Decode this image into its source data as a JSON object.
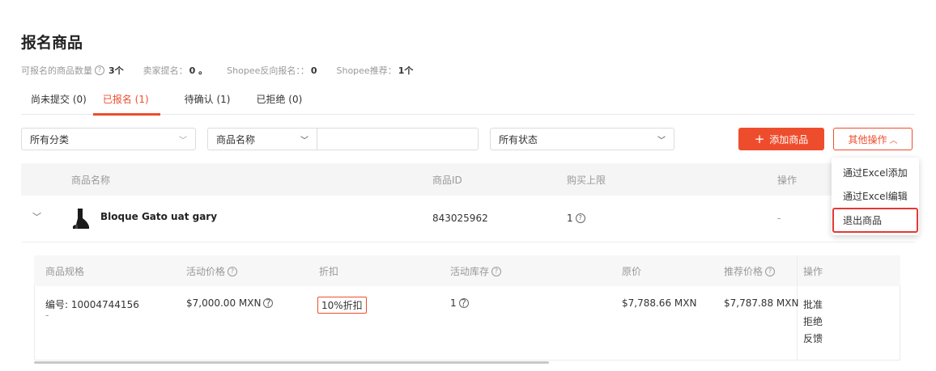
{
  "page": {
    "title": "报名商品"
  },
  "stats": {
    "registerable_label": "可报名的商品数量",
    "registerable_value": "3个",
    "seller_label": "卖家提名：",
    "seller_value": "0 。",
    "shopee_reverse_label": "Shopee反向报名：：",
    "shopee_reverse_value": "0",
    "shopee_recommend_label": "Shopee推荐：",
    "shopee_recommend_value": "1个"
  },
  "tabs": [
    {
      "label": "尚未提交 (0)"
    },
    {
      "label": "已报名 (1)",
      "active": true
    },
    {
      "label": "待确认 (1)"
    },
    {
      "label": "已拒绝 (0)"
    }
  ],
  "filters": {
    "category": "所有分类",
    "search_field": "商品名称",
    "search_value": "",
    "status": "所有状态"
  },
  "actions": {
    "add": "添加商品",
    "more": "其他操作"
  },
  "table": {
    "headers": [
      "商品名称",
      "商品ID",
      "购买上限",
      "操作"
    ],
    "row": {
      "name": "Bloque Gato uat gary",
      "id": "843025962",
      "limit": "1",
      "action": "-"
    }
  },
  "variant_table": {
    "headers": [
      "商品规格",
      "活动价格",
      "折扣",
      "活动库存",
      "原价",
      "推荐价格",
      "操作"
    ],
    "row": {
      "spec": "编号: 10004744156",
      "spec_sub": "-",
      "price": "$7,000.00 MXN",
      "discount": "10%折扣",
      "stock": "1",
      "original": "$7,788.66 MXN",
      "recommended": "$7,787.88 MXN",
      "actions": [
        "批准",
        "拒绝",
        "反馈"
      ]
    }
  },
  "dropdown": {
    "items": [
      "通过Excel添加",
      "通过Excel编辑",
      "退出商品"
    ]
  },
  "colors": {
    "brand": "#ee4d2d",
    "link": "#1475e1",
    "highlight": "#e53935"
  }
}
